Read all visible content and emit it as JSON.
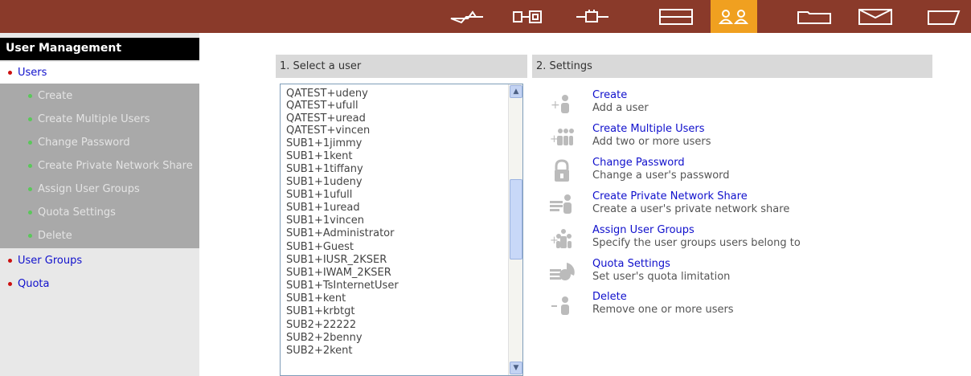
{
  "sidebar": {
    "title": "User Management",
    "items": [
      {
        "label": "Users",
        "type": "main"
      },
      {
        "label": "Create",
        "type": "sub"
      },
      {
        "label": "Create Multiple Users",
        "type": "sub"
      },
      {
        "label": "Change Password",
        "type": "sub"
      },
      {
        "label": "Create Private Network Share",
        "type": "sub"
      },
      {
        "label": "Assign User Groups",
        "type": "sub"
      },
      {
        "label": "Quota Settings",
        "type": "sub"
      },
      {
        "label": "Delete",
        "type": "sub"
      },
      {
        "label": "User Groups",
        "type": "main"
      },
      {
        "label": "Quota",
        "type": "main"
      }
    ]
  },
  "select_user": {
    "header": "1. Select a user",
    "users": [
      "QATEST+udeny",
      "QATEST+ufull",
      "QATEST+uread",
      "QATEST+vincen",
      "SUB1+1jimmy",
      "SUB1+1kent",
      "SUB1+1tiffany",
      "SUB1+1udeny",
      "SUB1+1ufull",
      "SUB1+1uread",
      "SUB1+1vincen",
      "SUB1+Administrator",
      "SUB1+Guest",
      "SUB1+IUSR_2KSER",
      "SUB1+IWAM_2KSER",
      "SUB1+TsInternetUser",
      "SUB1+kent",
      "SUB1+krbtgt",
      "SUB2+22222",
      "SUB2+2benny",
      "SUB2+2kent"
    ]
  },
  "settings": {
    "header": "2. Settings",
    "items": [
      {
        "title": "Create",
        "desc": "Add a user",
        "icon": "add-user-icon"
      },
      {
        "title": "Create Multiple Users",
        "desc": "Add two or more users",
        "icon": "add-multiple-users-icon"
      },
      {
        "title": "Change Password",
        "desc": "Change a user's password",
        "icon": "lock-icon"
      },
      {
        "title": "Create Private Network Share",
        "desc": "Create a user's private network share",
        "icon": "network-share-icon"
      },
      {
        "title": "Assign User Groups",
        "desc": "Specify the user groups users belong to",
        "icon": "assign-groups-icon"
      },
      {
        "title": "Quota Settings",
        "desc": "Set user's quota limitation",
        "icon": "quota-icon"
      },
      {
        "title": "Delete",
        "desc": "Remove one or more users",
        "icon": "remove-user-icon"
      }
    ]
  },
  "topnav": {
    "icons": [
      "network-icon",
      "device-icon",
      "plugin-icon",
      "storage-icon",
      "users-icon",
      "folder-icon",
      "envelope-icon",
      "tag-icon"
    ],
    "active": "users-icon"
  },
  "colors": {
    "topbar": "#8a3a2a",
    "active_tab": "#f0a020",
    "link": "#1010cc",
    "main_bullet": "#cc1010",
    "sub_bullet": "#5ac85a"
  }
}
